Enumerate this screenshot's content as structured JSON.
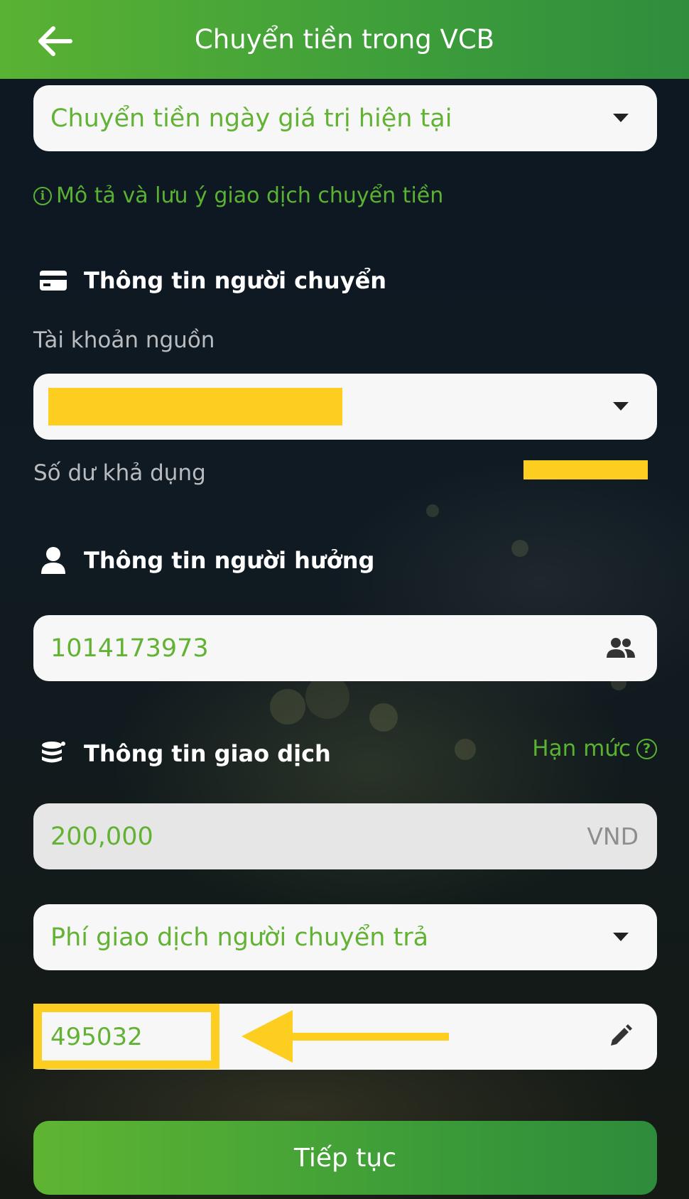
{
  "header": {
    "title": "Chuyển tiền trong VCB"
  },
  "transfer_type": {
    "value": "Chuyển tiền ngày giá trị hiện tại"
  },
  "info_link": {
    "label": "Mô tả và lưu ý giao dịch chuyển tiền"
  },
  "sender": {
    "section_title": "Thông tin người chuyển",
    "source_account_label": "Tài khoản nguồn",
    "balance_label": "Số dư khả dụng"
  },
  "beneficiary": {
    "section_title": "Thông tin người hưởng",
    "account_number": "1014173973"
  },
  "transaction": {
    "section_title": "Thông tin giao dịch",
    "limit_link": "Hạn mức",
    "amount": "200,000",
    "currency": "VND",
    "fee_option": "Phí giao dịch người chuyển trả",
    "description": "495032"
  },
  "continue_button": {
    "label": "Tiếp tục"
  },
  "colors": {
    "brand_green": "#5ab233",
    "highlight_yellow": "#fdce1f"
  }
}
